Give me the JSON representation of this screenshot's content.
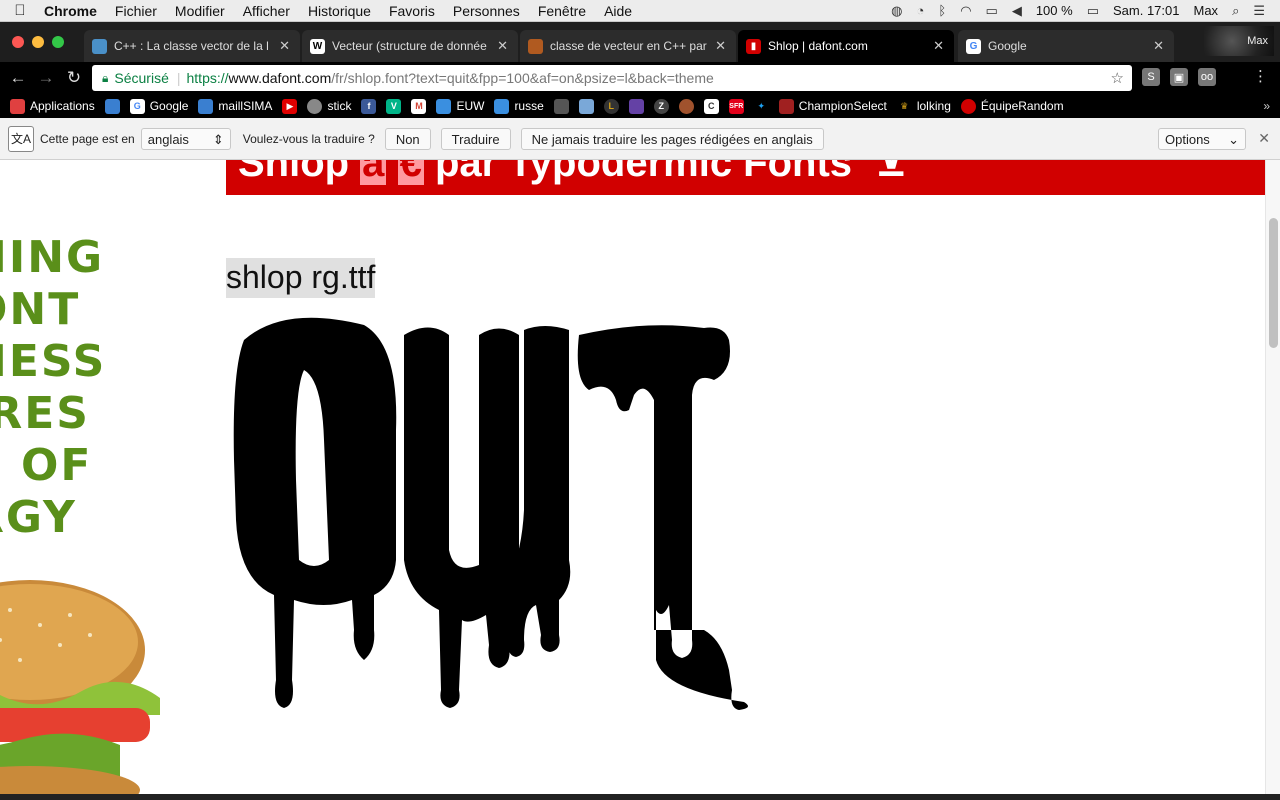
{
  "menubar": {
    "app": "Chrome",
    "items": [
      "Fichier",
      "Modifier",
      "Afficher",
      "Historique",
      "Favoris",
      "Personnes",
      "Fenêtre",
      "Aide"
    ],
    "battery": "100 %",
    "clock": "Sam. 17:01",
    "user": "Max"
  },
  "tabs": [
    {
      "title": "C++ : La classe vector de la l",
      "favicon_color": "#4a90c8"
    },
    {
      "title": "Vecteur (structure de donnée",
      "favicon_color": "#ffffff"
    },
    {
      "title": "classe de vecteur en C++ par",
      "favicon_color": "#b05a20"
    },
    {
      "title": "Shlop | dafont.com",
      "favicon_color": "#d10000"
    },
    {
      "title": "Google",
      "favicon_color": "#ffffff"
    }
  ],
  "profile_name": "Max",
  "omnibox": {
    "secure_label": "Sécurisé",
    "scheme": "https://",
    "host": "www.dafont.com",
    "path": "/fr/shlop.font?text=quit&fpp=100&af=on&psize=l&back=theme"
  },
  "bookmarks": [
    {
      "label": "Applications",
      "icon": "apps-grid-icon",
      "color": "#e04040"
    },
    {
      "label": "",
      "icon": "lol-icon",
      "color": "#3a7fd0"
    },
    {
      "label": "Google",
      "icon": "google-icon",
      "color": "#ffffff"
    },
    {
      "label": "maillSIMA",
      "icon": "mail-icon",
      "color": "#3a7fd0"
    },
    {
      "label": "",
      "icon": "youtube-icon",
      "color": "#e00000"
    },
    {
      "label": "stick",
      "icon": "stick-icon",
      "color": "#888888"
    },
    {
      "label": "",
      "icon": "facebook-icon",
      "color": "#3b5998"
    },
    {
      "label": "",
      "icon": "vine-icon",
      "color": "#00b488"
    },
    {
      "label": "",
      "icon": "gmail-icon",
      "color": "#d44638"
    },
    {
      "label": "EUW",
      "icon": "opgg-icon",
      "color": "#3a8fe0"
    },
    {
      "label": "russe",
      "icon": "opgg-icon",
      "color": "#3a8fe0"
    },
    {
      "label": "",
      "icon": "skill-icon",
      "color": "#555555"
    },
    {
      "label": "",
      "icon": "league-icon",
      "color": "#7aa8d8"
    },
    {
      "label": "",
      "icon": "lolking-icon",
      "color": "#333333"
    },
    {
      "label": "",
      "icon": "twitch-icon",
      "color": "#6441a5"
    },
    {
      "label": "",
      "icon": "zed-icon",
      "color": "#444444"
    },
    {
      "label": "",
      "icon": "poop-icon",
      "color": "#a0522d"
    },
    {
      "label": "",
      "icon": "c-icon",
      "color": "#666666"
    },
    {
      "label": "",
      "icon": "sfr-icon",
      "color": "#e2001a"
    },
    {
      "label": "",
      "icon": "twitter-icon",
      "color": "#1da1f2"
    },
    {
      "label": "ChampionSelect",
      "icon": "champion-icon",
      "color": "#a02020"
    },
    {
      "label": "lolking",
      "icon": "crown-icon",
      "color": "#d4a017"
    },
    {
      "label": "ÉquipeRandom",
      "icon": "team-icon",
      "color": "#d10000"
    }
  ],
  "translate_bar": {
    "page_is_in": "Cette page est en",
    "language": "anglais",
    "question": "Voulez-vous la traduire ?",
    "no": "Non",
    "translate": "Traduire",
    "never": "Ne jamais traduire les pages rédigées en anglais",
    "options": "Options"
  },
  "page": {
    "header_text_before": "Shlop ",
    "header_hl1": "à",
    "header_hl2": "€",
    "header_text_after": " par Typodermic Fonts",
    "font_file": "shlop rg.ttf",
    "preview_text": "QUIT",
    "ad_text_lines": [
      "NING",
      "ONT",
      "NESS",
      "IRES",
      "S OF",
      "RGY"
    ]
  },
  "colors": {
    "brand_red": "#d10000",
    "secure_green": "#0b8043",
    "ad_green": "#5a8f1a"
  }
}
